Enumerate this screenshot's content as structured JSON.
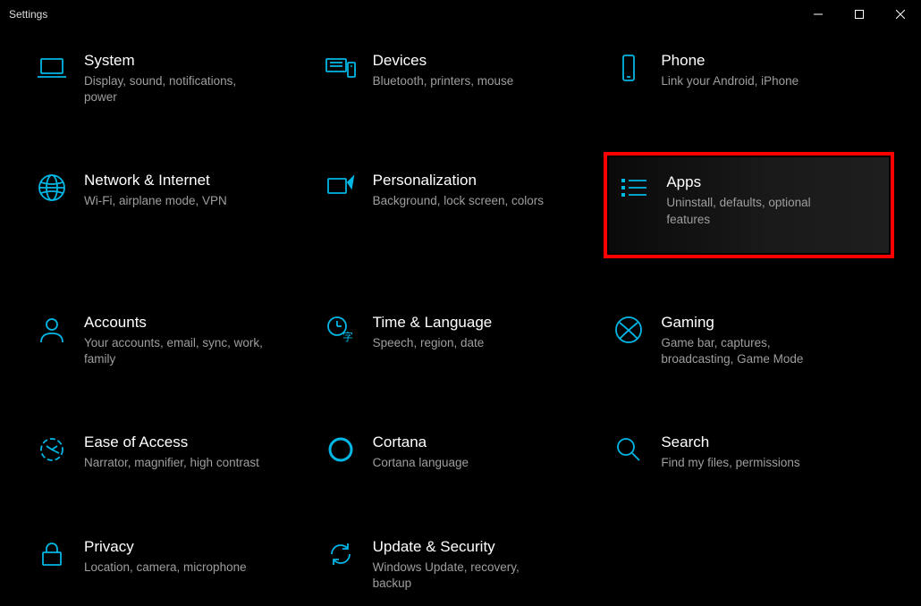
{
  "window": {
    "title": "Settings"
  },
  "tiles": [
    {
      "title": "System",
      "sub": "Display, sound, notifications, power",
      "icon": "laptop-icon",
      "highlight": false
    },
    {
      "title": "Devices",
      "sub": "Bluetooth, printers, mouse",
      "icon": "keyboard-icon",
      "highlight": false
    },
    {
      "title": "Phone",
      "sub": "Link your Android, iPhone",
      "icon": "phone-icon",
      "highlight": false
    },
    {
      "title": "Network & Internet",
      "sub": "Wi-Fi, airplane mode, VPN",
      "icon": "globe-icon",
      "highlight": false
    },
    {
      "title": "Personalization",
      "sub": "Background, lock screen, colors",
      "icon": "brush-icon",
      "highlight": false
    },
    {
      "title": "Apps",
      "sub": "Uninstall, defaults, optional features",
      "icon": "apps-icon",
      "highlight": true
    },
    {
      "title": "Accounts",
      "sub": "Your accounts, email, sync, work, family",
      "icon": "person-icon",
      "highlight": false
    },
    {
      "title": "Time & Language",
      "sub": "Speech, region, date",
      "icon": "time-lang-icon",
      "highlight": false
    },
    {
      "title": "Gaming",
      "sub": "Game bar, captures, broadcasting, Game Mode",
      "icon": "xbox-icon",
      "highlight": false
    },
    {
      "title": "Ease of Access",
      "sub": "Narrator, magnifier, high contrast",
      "icon": "ease-icon",
      "highlight": false
    },
    {
      "title": "Cortana",
      "sub": "Cortana language",
      "icon": "cortana-icon",
      "highlight": false
    },
    {
      "title": "Search",
      "sub": "Find my files, permissions",
      "icon": "search-icon",
      "highlight": false
    },
    {
      "title": "Privacy",
      "sub": "Location, camera, microphone",
      "icon": "lock-icon",
      "highlight": false
    },
    {
      "title": "Update & Security",
      "sub": "Windows Update, recovery, backup",
      "icon": "update-icon",
      "highlight": false
    }
  ]
}
